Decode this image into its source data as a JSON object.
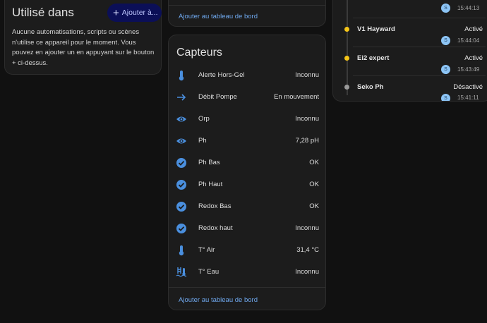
{
  "used_in": {
    "title": "Utilisé dans",
    "add_button": "Ajouter à...",
    "text": "Aucune automatisations, scripts ou scènes n'utilise ce appareil pour le moment. Vous pouvez en ajouter un en appuyant sur le bouton + ci-dessus."
  },
  "top_card": {
    "dashboard_link": "Ajouter au tableau de bord"
  },
  "sensors": {
    "title": "Capteurs",
    "dashboard_link": "Ajouter au tableau de bord",
    "accent_color": "#4a8fde",
    "items": [
      {
        "icon": "thermometer-icon",
        "name": "Alerte Hors-Gel",
        "value": "Inconnu"
      },
      {
        "icon": "arrow-right-icon",
        "name": "Débit Pompe",
        "value": "En mouvement"
      },
      {
        "icon": "eye-icon",
        "name": "Orp",
        "value": "Inconnu"
      },
      {
        "icon": "eye-icon",
        "name": "Ph",
        "value": "7,28 pH"
      },
      {
        "icon": "check-circle-icon",
        "name": "Ph Bas",
        "value": "OK"
      },
      {
        "icon": "check-circle-icon",
        "name": "Ph Haut",
        "value": "OK"
      },
      {
        "icon": "check-circle-icon",
        "name": "Redox Bas",
        "value": "OK"
      },
      {
        "icon": "check-circle-icon",
        "name": "Redox haut",
        "value": "Inconnu"
      },
      {
        "icon": "thermometer-icon",
        "name": "T° Air",
        "value": "31,4 °C"
      },
      {
        "icon": "pool-thermometer-icon",
        "name": "T° Eau",
        "value": "Inconnu"
      }
    ]
  },
  "logbook": {
    "colors": {
      "on": "#f5c518",
      "off": "#9a9a9a",
      "line": "#3a3a3a"
    },
    "entries": [
      {
        "name": "",
        "state": "",
        "avatar": "S",
        "time": "15:44:13",
        "status": "none"
      },
      {
        "name": "V1 Hayward",
        "state": "Activé",
        "avatar": "S",
        "time": "15:44:04",
        "status": "on"
      },
      {
        "name": "Ei2 expert",
        "state": "Activé",
        "avatar": "S",
        "time": "15:43:49",
        "status": "on"
      },
      {
        "name": "Seko Ph",
        "state": "Désactivé",
        "avatar": "S",
        "time": "15:41:11",
        "status": "off"
      }
    ]
  }
}
